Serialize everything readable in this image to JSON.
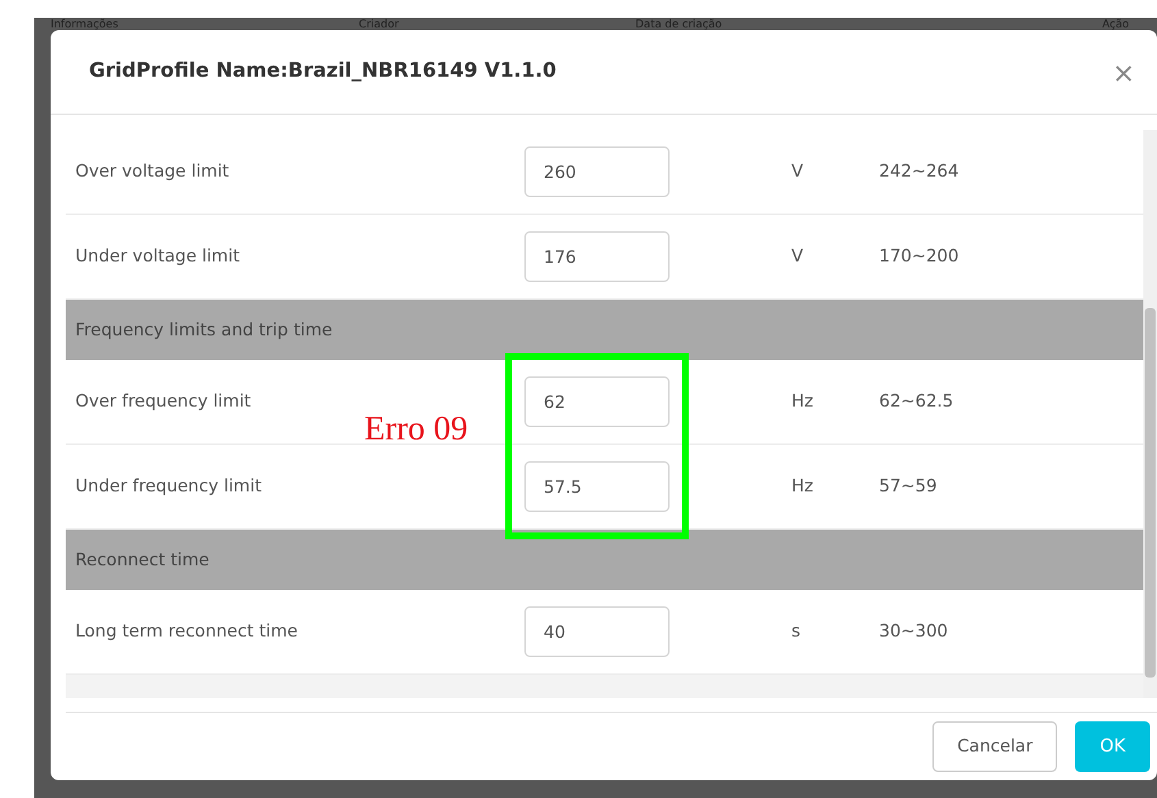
{
  "background_table": {
    "columns": [
      "Informações",
      "Criador",
      "Data de criação",
      "Ação"
    ]
  },
  "dialog": {
    "title": "GridProfile Name:Brazil_NBR16149 V1.1.0",
    "close": "×",
    "rows": [
      {
        "kind": "field",
        "label": "Over voltage limit",
        "value": "260",
        "unit": "V",
        "range": "242~264"
      },
      {
        "kind": "field",
        "label": "Under voltage limit",
        "value": "176",
        "unit": "V",
        "range": "170~200"
      },
      {
        "kind": "section",
        "label": "Frequency limits and trip time"
      },
      {
        "kind": "field",
        "label": "Over frequency limit",
        "value": "62",
        "unit": "Hz",
        "range": "62~62.5"
      },
      {
        "kind": "field",
        "label": "Under frequency limit",
        "value": "57.5",
        "unit": "Hz",
        "range": "57~59"
      },
      {
        "kind": "section",
        "label": "Reconnect time"
      },
      {
        "kind": "field",
        "label": "Long term reconnect time",
        "value": "40",
        "unit": "s",
        "range": "30~300"
      }
    ],
    "buttons": [
      {
        "kind": "secondary",
        "label": "Cancelar"
      },
      {
        "kind": "primary",
        "label": "OK"
      }
    ]
  },
  "annotation": {
    "text": "Erro 09"
  }
}
